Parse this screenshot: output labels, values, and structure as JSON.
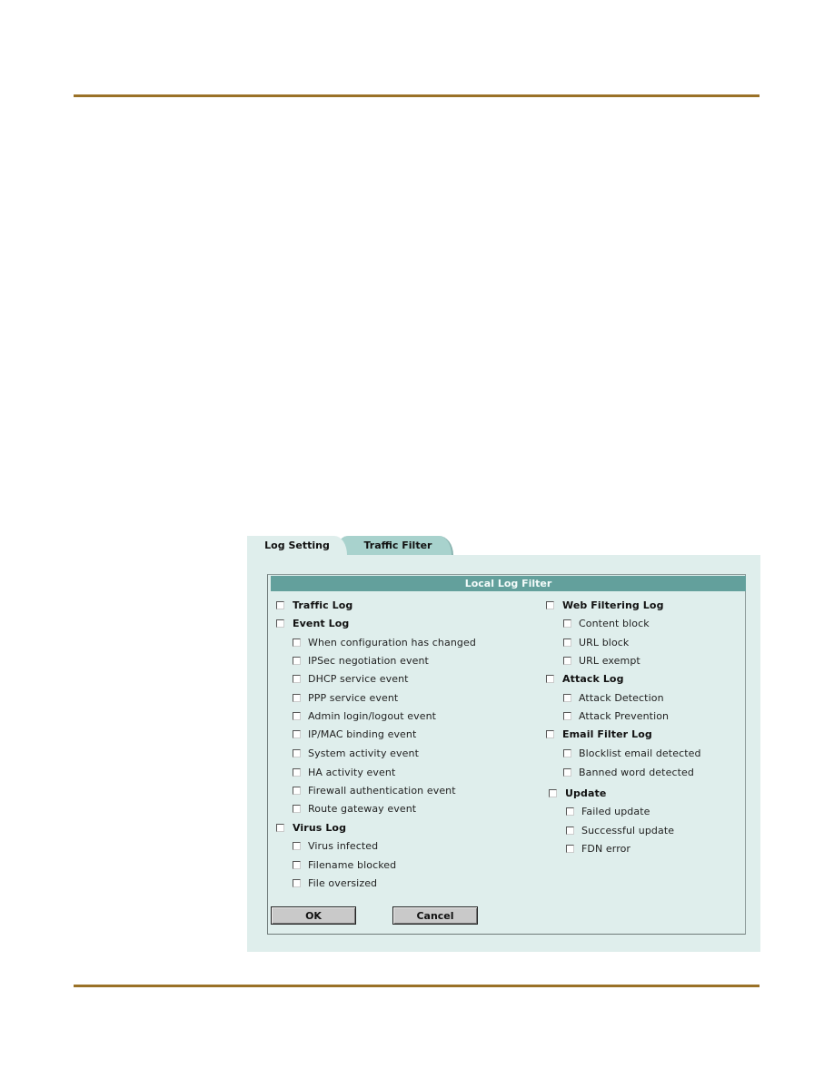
{
  "tabs": [
    {
      "label": "Log Setting",
      "active": true
    },
    {
      "label": "Traffic Filter",
      "active": false
    }
  ],
  "panel_title": "Local Log Filter",
  "left_column": [
    {
      "label": "Traffic Log",
      "type": "group",
      "checked": false
    },
    {
      "label": "Event Log",
      "type": "group",
      "checked": false
    },
    {
      "label": "When configuration has changed",
      "type": "sub",
      "checked": false
    },
    {
      "label": "IPSec negotiation event",
      "type": "sub",
      "checked": false
    },
    {
      "label": "DHCP service event",
      "type": "sub",
      "checked": false
    },
    {
      "label": "PPP service event",
      "type": "sub",
      "checked": false
    },
    {
      "label": "Admin login/logout event",
      "type": "sub",
      "checked": false
    },
    {
      "label": "IP/MAC binding event",
      "type": "sub",
      "checked": false
    },
    {
      "label": "System activity event",
      "type": "sub",
      "checked": false
    },
    {
      "label": "HA activity event",
      "type": "sub",
      "checked": false
    },
    {
      "label": "Firewall authentication event",
      "type": "sub",
      "checked": false
    },
    {
      "label": "Route gateway event",
      "type": "sub",
      "checked": false
    },
    {
      "label": "Virus Log",
      "type": "group",
      "checked": false
    },
    {
      "label": "Virus infected",
      "type": "sub",
      "checked": false
    },
    {
      "label": "Filename blocked",
      "type": "sub",
      "checked": false
    },
    {
      "label": "File oversized",
      "type": "sub",
      "checked": false
    }
  ],
  "right_column": [
    {
      "label": "Web Filtering Log",
      "type": "group",
      "checked": false
    },
    {
      "label": "Content block",
      "type": "sub",
      "checked": false
    },
    {
      "label": "URL block",
      "type": "sub",
      "checked": false
    },
    {
      "label": "URL exempt",
      "type": "sub",
      "checked": false
    },
    {
      "label": "Attack Log",
      "type": "group",
      "checked": false
    },
    {
      "label": "Attack Detection",
      "type": "sub",
      "checked": false
    },
    {
      "label": "Attack Prevention",
      "type": "sub",
      "checked": false
    },
    {
      "label": "Email Filter Log",
      "type": "group",
      "checked": false
    },
    {
      "label": "Blocklist email detected",
      "type": "sub",
      "checked": false
    },
    {
      "label": "Banned word detected",
      "type": "sub",
      "checked": false
    },
    {
      "label": "Update",
      "type": "group",
      "checked": false
    },
    {
      "label": "Failed update",
      "type": "sub",
      "checked": false
    },
    {
      "label": "Successful update",
      "type": "sub",
      "checked": false
    },
    {
      "label": "FDN error",
      "type": "sub",
      "checked": false
    }
  ],
  "buttons": {
    "ok": "OK",
    "cancel": "Cancel"
  },
  "colors": {
    "rule": "#9a7127",
    "panel_bg": "#dfeeec",
    "header_bg": "#63a09c",
    "inactive_tab": "#a8d2cd"
  }
}
